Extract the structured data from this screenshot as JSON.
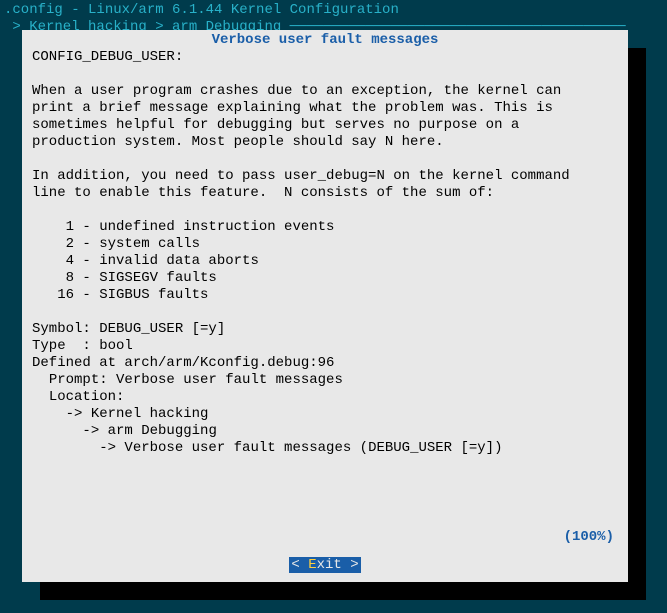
{
  "background": {
    "title_line": ".config - Linux/arm 6.1.44 Kernel Configuration",
    "breadcrumb_line": " > Kernel hacking > arm Debugging ────────────────────────────────────────"
  },
  "dialog": {
    "title": "Verbose user fault messages",
    "body": "CONFIG_DEBUG_USER:\n\nWhen a user program crashes due to an exception, the kernel can\nprint a brief message explaining what the problem was. This is\nsometimes helpful for debugging but serves no purpose on a\nproduction system. Most people should say N here.\n\nIn addition, you need to pass user_debug=N on the kernel command\nline to enable this feature.  N consists of the sum of:\n\n    1 - undefined instruction events\n    2 - system calls\n    4 - invalid data aborts\n    8 - SIGSEGV faults\n   16 - SIGBUS faults\n\nSymbol: DEBUG_USER [=y]\nType  : bool\nDefined at arch/arm/Kconfig.debug:96\n  Prompt: Verbose user fault messages\n  Location:\n    -> Kernel hacking\n      -> arm Debugging\n        -> Verbose user fault messages (DEBUG_USER [=y])",
    "percent": "(100%)",
    "button": {
      "open": "< ",
      "hotkey": "E",
      "rest": "xit >"
    }
  }
}
